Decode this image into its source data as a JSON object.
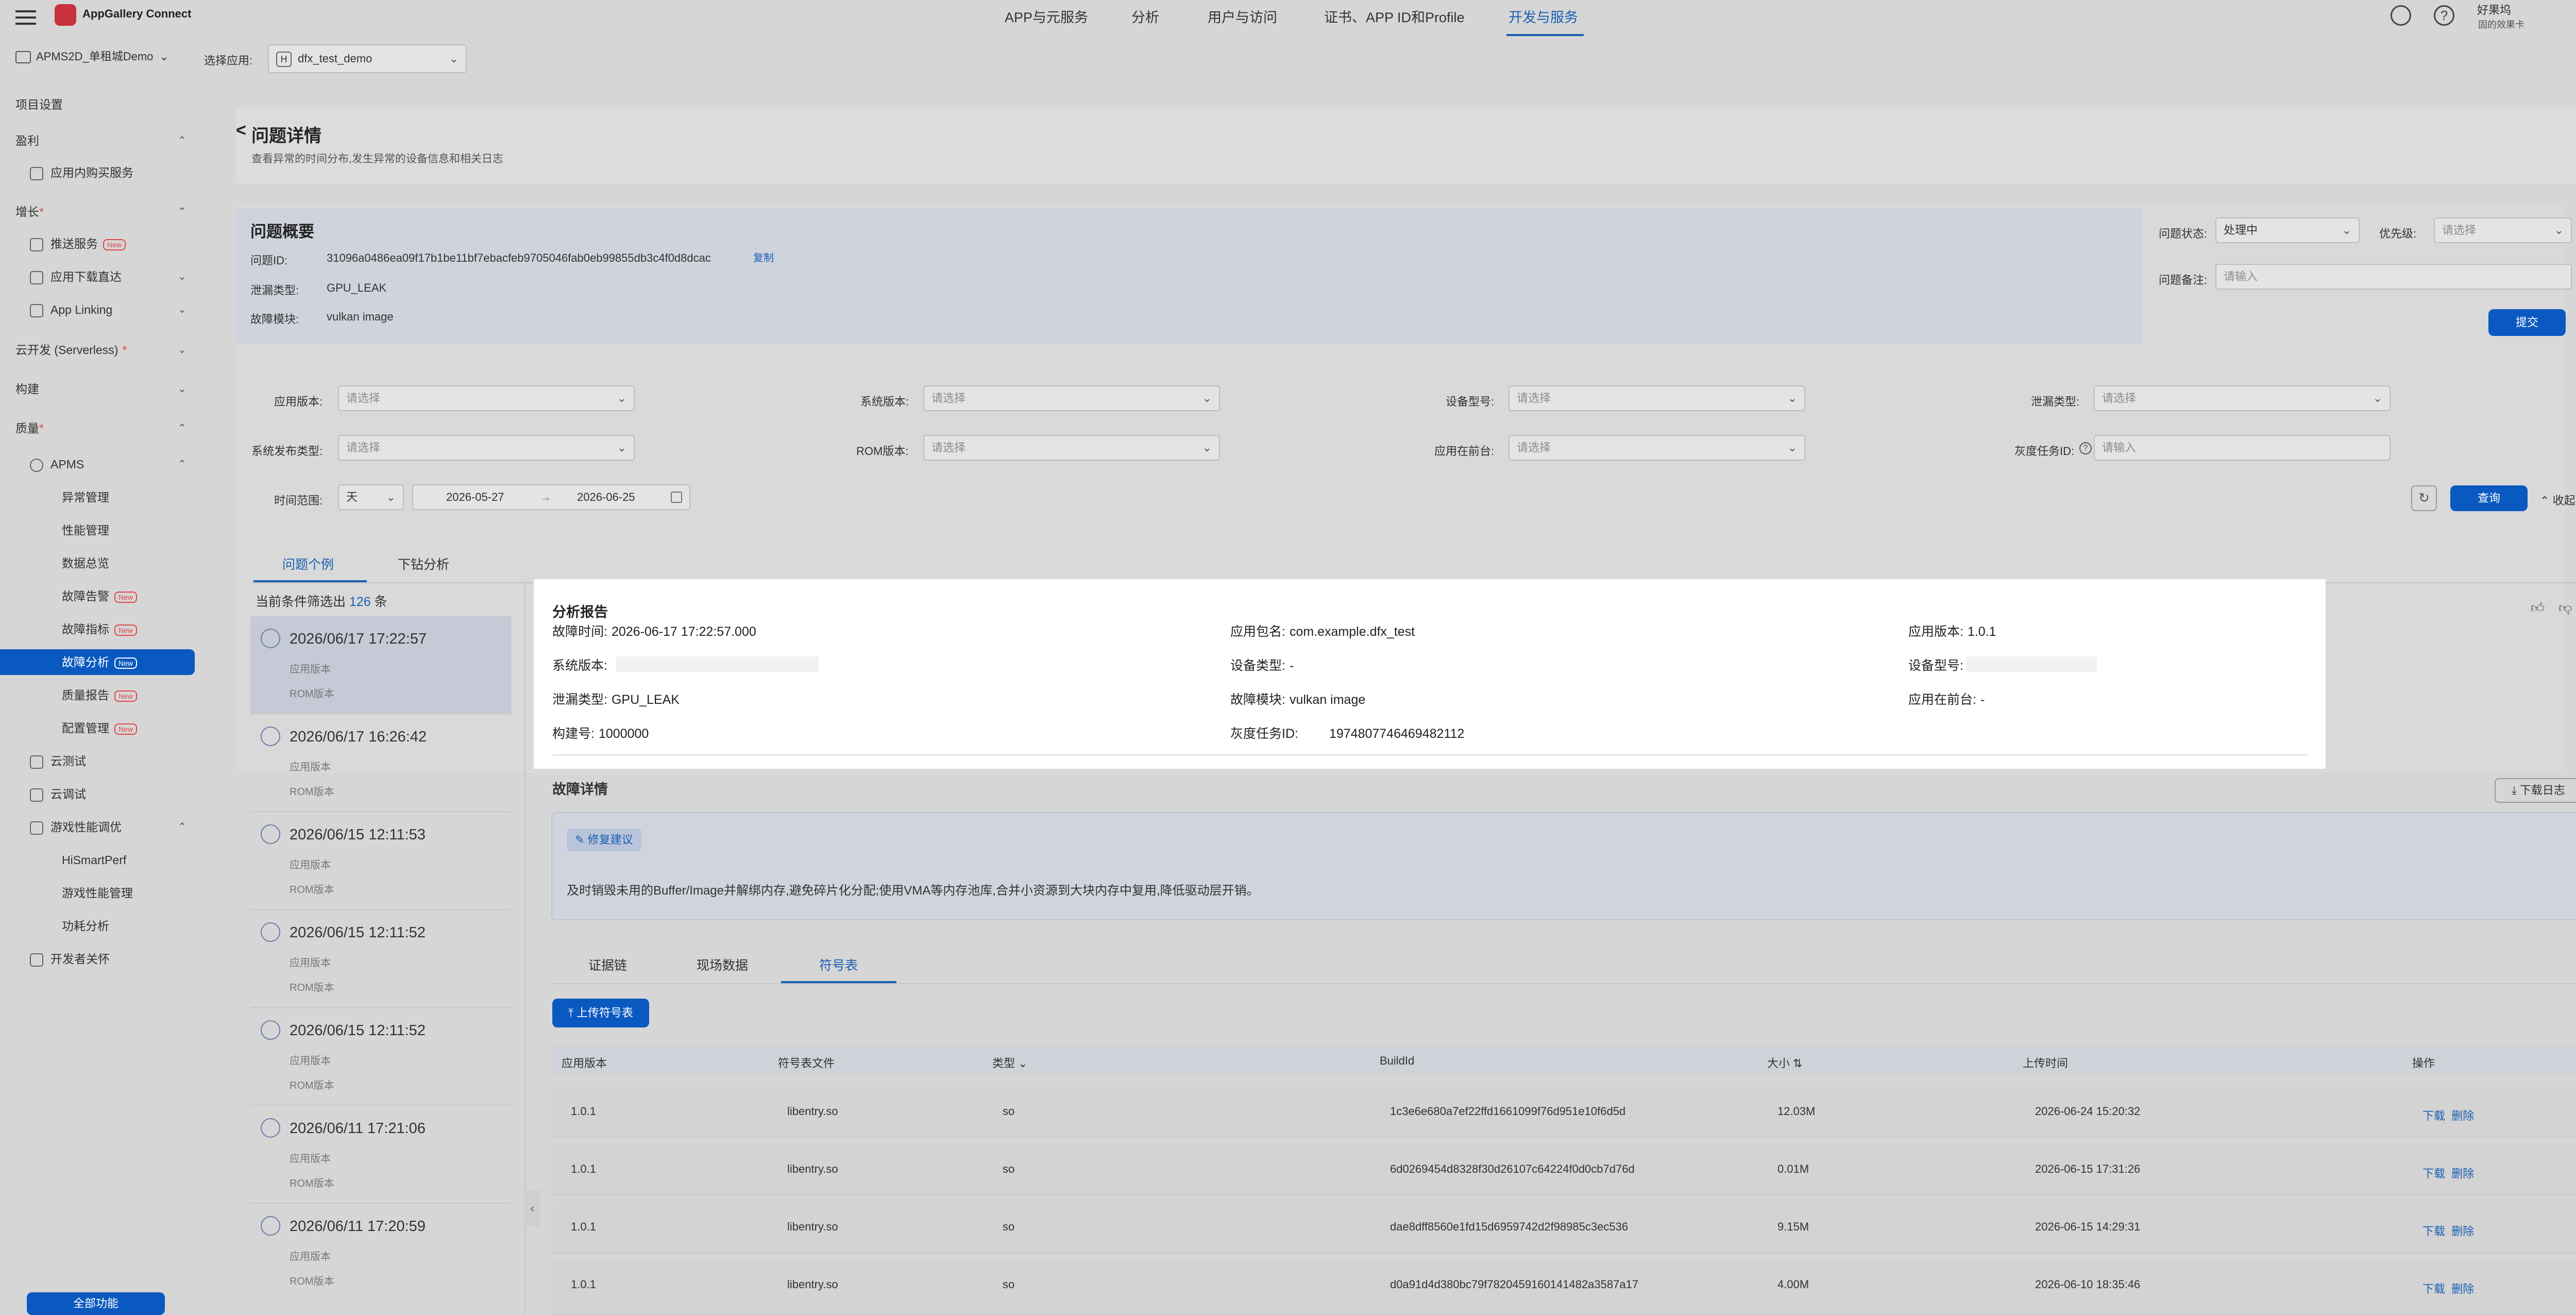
{
  "header": {
    "brand": "AppGallery Connect",
    "nav": [
      "APP与元服务",
      "分析",
      "用户与访问",
      "证书、APP ID和Profile",
      "开发与服务"
    ],
    "active_nav": "开发与服务",
    "user_name": "好果坞",
    "user_sub": "固的效果卡"
  },
  "toolbar": {
    "project": "APMS2D_单租城Demo",
    "select_app_label": "选择应用:",
    "selected_app": "dfx_test_demo",
    "app_badge": "H"
  },
  "sidebar": {
    "project_settings": "项目设置",
    "groups": [
      {
        "label": "盈利",
        "items": [
          "应用内购买服务"
        ]
      },
      {
        "label": "增长",
        "items": [
          "推送服务",
          "应用下载直达",
          "App Linking"
        ]
      },
      {
        "label": "云开发 (Serverless)",
        "items": []
      },
      {
        "label": "构建",
        "items": []
      },
      {
        "label": "质量",
        "items": [
          "APMS",
          "异常管理",
          "性能管理",
          "数据总览",
          "故障告警",
          "故障指标",
          "故障分析",
          "质量报告",
          "配置管理",
          "云测试",
          "云调试",
          "游戏性能调优",
          "HiSmartPerf",
          "游戏性能管理",
          "功耗分析",
          "开发者关怀"
        ]
      }
    ],
    "new_badge": "New",
    "all_functions": "全部功能"
  },
  "page": {
    "back": "<",
    "title": "问题详情",
    "subtitle": "查看异常的时间分布,发生异常的设备信息和相关日志"
  },
  "overview": {
    "heading": "问题概要",
    "issue_id_label": "问题ID:",
    "issue_id": "31096a0486ea09f17b1be11bf7ebacfeb9705046fab0eb99855db3c4f0d8dcac",
    "copy": "复制",
    "leak_type_label": "泄漏类型:",
    "leak_type": "GPU_LEAK",
    "module_label": "故障模块:",
    "module": "vulkan image",
    "status_label": "问题状态:",
    "status_value": "处理中",
    "priority_label": "优先级:",
    "priority_placeholder": "请选择",
    "note_label": "问题备注:",
    "note_placeholder": "请输入",
    "submit": "提交"
  },
  "filters": {
    "app_version": "应用版本:",
    "sys_version": "系统版本:",
    "device_model": "设备型号:",
    "leak_type": "泄漏类型:",
    "sys_release_type": "系统发布类型:",
    "rom_version": "ROM版本:",
    "foreground": "应用在前台:",
    "gray_task": "灰度任务ID:",
    "select_placeholder": "请选择",
    "input_placeholder": "请输入",
    "time_range": "时间范围:",
    "unit": "天",
    "date_from": "2026-05-27",
    "date_sep": "→",
    "date_to": "2026-06-25",
    "query": "查询",
    "collapse": "收起"
  },
  "tabs": {
    "items": [
      "问题个例",
      "下钻分析"
    ],
    "active": "问题个例"
  },
  "list": {
    "summary_prefix": "当前条件筛选出",
    "count": "126",
    "summary_suffix": "条",
    "l1": "应用版本",
    "l2": "ROM版本",
    "items": [
      "2026/06/17 17:22:57",
      "2026/06/17 16:26:42",
      "2026/06/15 12:11:53",
      "2026/06/15 12:11:52",
      "2026/06/15 12:11:52",
      "2026/06/11 17:21:06",
      "2026/06/11 17:20:59"
    ]
  },
  "report": {
    "heading": "分析报告",
    "fault_time_label": "故障时间:",
    "fault_time": "2026-06-17 17:22:57.000",
    "package_label": "应用包名:",
    "package": "com.example.dfx_test",
    "app_version_label": "应用版本:",
    "app_version": "1.0.1",
    "sys_version_label": "系统版本:",
    "device_type_label": "设备类型:",
    "device_type": "-",
    "device_model_label": "设备型号:",
    "leak_type_label": "泄漏类型:",
    "leak_type": "GPU_LEAK",
    "module_label": "故障模块:",
    "module": "vulkan image",
    "foreground_label": "应用在前台:",
    "foreground": "-",
    "build_label": "构建号:",
    "build": "1000000",
    "gray_label": "灰度任务ID:",
    "gray": "1974807746469482112"
  },
  "detail": {
    "heading": "故障详情",
    "download_log": "下载日志",
    "fix_tag": "修复建议",
    "fix_text": "及时销毁未用的Buffer/Image并解绑内存,避免碎片化分配;使用VMA等内存池库,合并小资源到大块内存中复用,降低驱动层开销。",
    "sub_tabs": [
      "证据链",
      "现场数据",
      "符号表"
    ],
    "active_sub_tab": "符号表",
    "upload": "上传符号表"
  },
  "symbol_table": {
    "headers": [
      "应用版本",
      "符号表文件",
      "类型",
      "BuildId",
      "大小",
      "上传时间",
      "操作"
    ],
    "rows": [
      {
        "version": "1.0.1",
        "file": "libentry.so",
        "type": "so",
        "buildid": "1c3e6e680a7ef22ffd1661099f76d951e10f6d5d",
        "size": "12.03M",
        "time": "2026-06-24 15:20:32"
      },
      {
        "version": "1.0.1",
        "file": "libentry.so",
        "type": "so",
        "buildid": "6d0269454d8328f30d26107c64224f0d0cb7d76d",
        "size": "0.01M",
        "time": "2026-06-15 17:31:26"
      },
      {
        "version": "1.0.1",
        "file": "libentry.so",
        "type": "so",
        "buildid": "dae8dff8560e1fd15d6959742d2f98985c3ec536",
        "size": "9.15M",
        "time": "2026-06-15 14:29:31"
      },
      {
        "version": "1.0.1",
        "file": "libentry.so",
        "type": "so",
        "buildid": "d0a91d4d380bc79f7820459160141482a3587a17",
        "size": "4.00M",
        "time": "2026-06-10 18:35:46"
      }
    ],
    "download": "下载",
    "delete": "删除"
  },
  "colors": {
    "accent": "#0a59c0",
    "overlay_bg": "#d6d6d6",
    "panel": "#ffffff",
    "new_badge": "#e04848"
  }
}
